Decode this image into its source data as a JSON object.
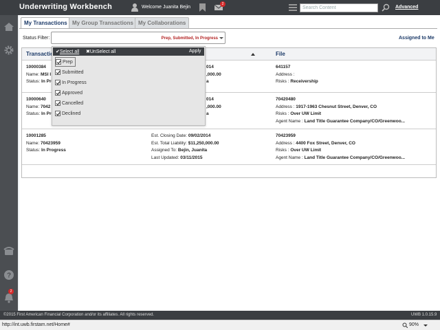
{
  "header": {
    "title": "Underwriting Workbench",
    "welcome": "Welcome Juanita Bejin",
    "mail_count": "2",
    "search_placeholder": "Search Content",
    "advanced": "Advanced"
  },
  "sidebar": {
    "notification_count": "2",
    "icons": [
      "home-icon",
      "gear-icon",
      "phone-icon",
      "help-icon",
      "bell-icon"
    ]
  },
  "tabs": [
    {
      "label": "My Transactions",
      "active": true
    },
    {
      "label": "My Group Transactions",
      "active": false
    },
    {
      "label": "My Collaborations",
      "active": false
    }
  ],
  "filter": {
    "label": "Status Filter:",
    "value": "Prep, Submitted, In Progress",
    "assigned_link": "Assigned to Me"
  },
  "dropdown": {
    "select_all": "Select all",
    "unselect_all": "UnSelect all",
    "apply": "Apply",
    "options": [
      {
        "label": "Prep",
        "checked": true
      },
      {
        "label": "Submitted",
        "checked": true
      },
      {
        "label": "In Progress",
        "checked": true
      },
      {
        "label": "Approved",
        "checked": true
      },
      {
        "label": "Cancelled",
        "checked": true
      },
      {
        "label": "Declined",
        "checked": true
      }
    ]
  },
  "grid": {
    "columns": [
      "Transaction",
      "File"
    ],
    "rows": [
      {
        "col1": [
          {
            "label": "",
            "value": "10000384"
          },
          {
            "label": "Name: ",
            "value": "MSI I"
          },
          {
            "label": "Status: ",
            "value": "In Progress"
          }
        ],
        "col2": [
          {
            "label": "",
            "value": "014"
          },
          {
            "label": "",
            "value": ",000.00"
          },
          {
            "label": "",
            "value": "a"
          }
        ],
        "col3": [
          {
            "label": "",
            "value": "641157"
          },
          {
            "label": "Address : ",
            "value": ""
          },
          {
            "label": "Risks : ",
            "value": "Receivership"
          }
        ]
      },
      {
        "col1": [
          {
            "label": "",
            "value": "10000640"
          },
          {
            "label": "Name: ",
            "value": "7042"
          },
          {
            "label": "Status: ",
            "value": "In Pro"
          }
        ],
        "col2": [
          {
            "label": "",
            "value": "014"
          },
          {
            "label": "",
            "value": ",000.00"
          },
          {
            "label": "",
            "value": "a"
          }
        ],
        "col3": [
          {
            "label": "",
            "value": "70420480"
          },
          {
            "label": "Address : ",
            "value": "1917-1963 Chesnut Street, Denver, CO"
          },
          {
            "label": "Risks : ",
            "value": "Over UW Limit"
          },
          {
            "label": "Agent Name : ",
            "value": "Land Title Guarantee Company/CO/Greenwoo..."
          }
        ]
      },
      {
        "col1": [
          {
            "label": "",
            "value": "10001285"
          },
          {
            "label": "Name: ",
            "value": "70423959"
          },
          {
            "label": "Status: ",
            "value": "In Progress"
          }
        ],
        "col2": [
          {
            "label": "Est. Closing Date: ",
            "value": "09/02/2014"
          },
          {
            "label": "Est. Total Liability: ",
            "value": "$11,250,000.00"
          },
          {
            "label": "Assigned To: ",
            "value": "Bejin, Juanita"
          },
          {
            "label": "Last Updated: ",
            "value": "03/11/2015"
          }
        ],
        "col3": [
          {
            "label": "",
            "value": "70423959"
          },
          {
            "label": "Address : ",
            "value": "4400 Fox Street, Denver, CO"
          },
          {
            "label": "Risks : ",
            "value": "Over UW Limit"
          },
          {
            "label": "Agent Name : ",
            "value": "Land Title Guarantee Company/CO/Greenwoo..."
          }
        ]
      }
    ]
  },
  "footer": {
    "copyright": "©2015 First American Financial Corporation and/or its affiliates. All rights reserved.",
    "version": "UWB 1.0.15.9"
  },
  "statusbar": {
    "url": "http://int.uwb.firstam.net/Home#",
    "zoom": "90%"
  },
  "colors": {
    "header_bg": "#3b3e42",
    "accent_navy": "#1c3a68",
    "filter_red": "#b22222",
    "badge_red": "#d42a2a"
  }
}
